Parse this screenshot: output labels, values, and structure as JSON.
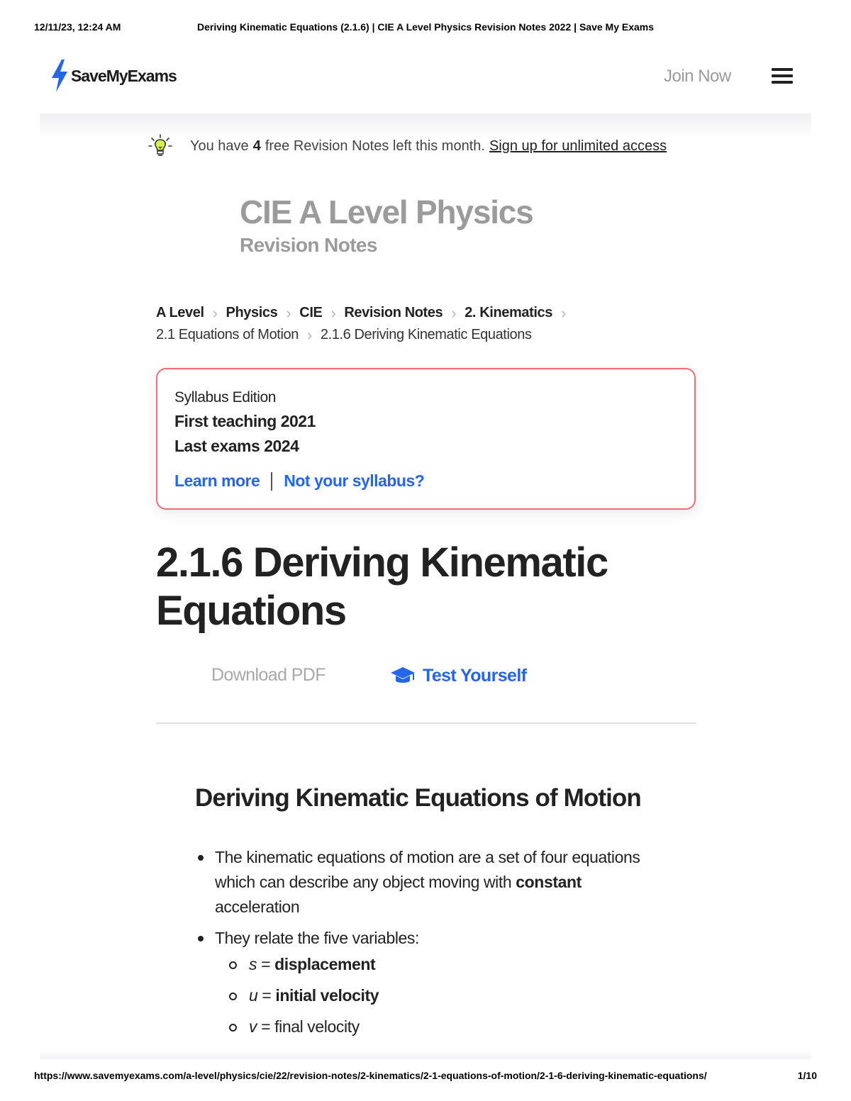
{
  "print_header": {
    "date": "12/11/23, 12:24 AM",
    "title": "Deriving Kinematic Equations (2.1.6) | CIE A Level Physics Revision Notes 2022 | Save My Exams"
  },
  "print_footer": {
    "url": "https://www.savemyexams.com/a-level/physics/cie/22/revision-notes/2-kinematics/2-1-equations-of-motion/2-1-6-deriving-kinematic-equations/",
    "page": "1/10"
  },
  "nav": {
    "logo_text": "SaveMyExams",
    "join_label": "Join Now",
    "brand_color": "#2566e8"
  },
  "banner": {
    "prefix": "You have",
    "count": "4",
    "suffix": "free Revision Notes left this month.",
    "link": "Sign up for unlimited access"
  },
  "course": {
    "title": "CIE A Level Physics",
    "subtitle": "Revision Notes"
  },
  "breadcrumb": {
    "items": [
      "A Level",
      "Physics",
      "CIE",
      "Revision Notes",
      "2. Kinematics",
      "2.1 Equations of Motion",
      "2.1.6 Deriving Kinematic Equations"
    ]
  },
  "syllabus": {
    "label": "Syllabus Edition",
    "first_teaching": "First teaching 2021",
    "last_exams": "Last exams 2024",
    "learn_more": "Learn more",
    "not_yours": "Not your syllabus?",
    "border_color": "#f06d75"
  },
  "article": {
    "title": "2.1.6 Deriving Kinematic Equations",
    "download_label": "Download PDF",
    "test_label": "Test Yourself",
    "section_heading": "Deriving Kinematic Equations of Motion",
    "bullet1_pre": "The kinematic equations of motion are a set of four equations which can describe any object moving with",
    "bullet1_bold": "constant",
    "bullet1_post": "acceleration",
    "bullet2": "They relate the five variables:",
    "variables": [
      {
        "symbol": "s",
        "eq": " = ",
        "name": "displacement",
        "bold": true
      },
      {
        "symbol": "u",
        "eq": " = ",
        "name": "initial velocity",
        "bold": true
      },
      {
        "symbol": "v",
        "eq": " = ",
        "name": "final velocity",
        "bold": false
      }
    ]
  }
}
